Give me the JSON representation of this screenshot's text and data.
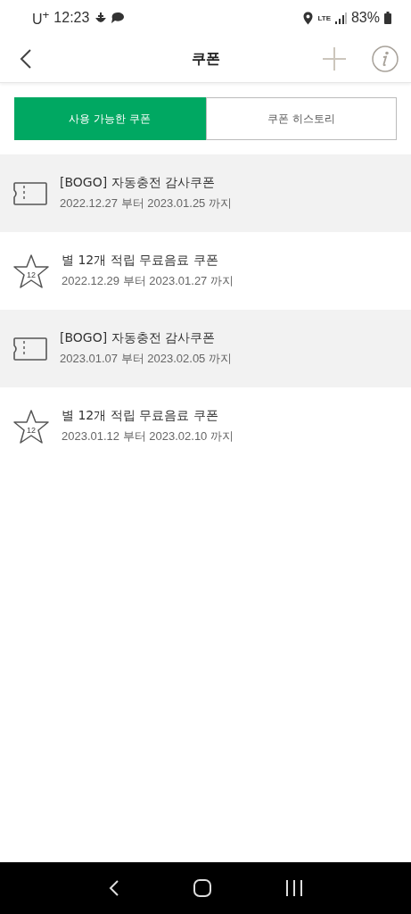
{
  "status_bar": {
    "carrier": "U$^{+}$",
    "time": "12:23",
    "network": "LTE",
    "battery": "83%"
  },
  "header": {
    "title": "쿠폰"
  },
  "tabs": [
    {
      "label": "사용 가능한 쿠폰",
      "selected": true
    },
    {
      "label": "쿠폰 히스토리",
      "selected": false
    }
  ],
  "coupons": [
    {
      "kind": "ticket",
      "title": "[BOGO] 자동충전 감사쿠폰",
      "period": "2022.12.27 부터 2023.01.25 까지"
    },
    {
      "kind": "star",
      "badge": "12",
      "title": "별 12개 적립 무료음료 쿠폰",
      "period": "2022.12.29 부터 2023.01.27 까지"
    },
    {
      "kind": "ticket",
      "title": "[BOGO] 자동충전 감사쿠폰",
      "period": "2023.01.07 부터 2023.02.05 까지"
    },
    {
      "kind": "star",
      "badge": "12",
      "title": "별 12개 적립 무료음료 쿠폰",
      "period": "2023.01.12 부터 2023.02.10 까지"
    }
  ]
}
